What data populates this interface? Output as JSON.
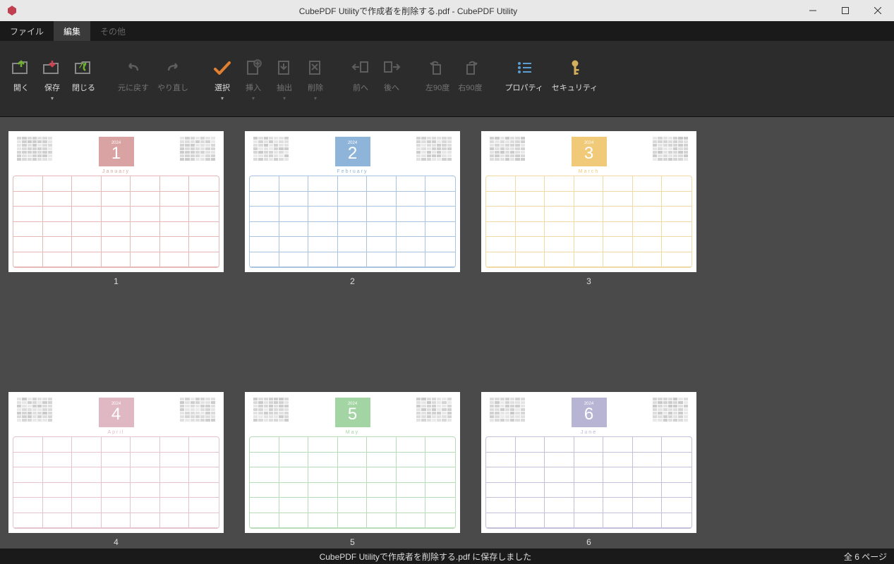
{
  "window": {
    "title": "CubePDF Utilityで作成者を削除する.pdf - CubePDF Utility"
  },
  "menus": {
    "file": "ファイル",
    "edit": "編集",
    "other": "その他"
  },
  "ribbon": {
    "open": "開く",
    "save": "保存",
    "close": "閉じる",
    "undo": "元に戻す",
    "redo": "やり直し",
    "select": "選択",
    "insert": "挿入",
    "extract": "抽出",
    "delete": "削除",
    "prev": "前へ",
    "next": "後へ",
    "rot_left": "左90度",
    "rot_right": "右90度",
    "property": "プロパティ",
    "security": "セキュリティ"
  },
  "thumbnails": [
    {
      "label": "1",
      "month_num": "1",
      "month_name": "January",
      "year": "2024",
      "accent": "#d9a3a3",
      "grid": "#e6b8b8"
    },
    {
      "label": "2",
      "month_num": "2",
      "month_name": "February",
      "year": "2024",
      "accent": "#8fb4d9",
      "grid": "#a8c4e0"
    },
    {
      "label": "3",
      "month_num": "3",
      "month_name": "March",
      "year": "2024",
      "accent": "#f0c979",
      "grid": "#f0d9a3"
    },
    {
      "label": "4",
      "month_num": "4",
      "month_name": "April",
      "year": "2024",
      "accent": "#e0b8c4",
      "grid": "#e6c4ce"
    },
    {
      "label": "5",
      "month_num": "5",
      "month_name": "May",
      "year": "2024",
      "accent": "#a3d4a3",
      "grid": "#b8dcb8"
    },
    {
      "label": "6",
      "month_num": "6",
      "month_name": "June",
      "year": "2024",
      "accent": "#b8b4d4",
      "grid": "#c4c0dc"
    }
  ],
  "status": {
    "message": "CubePDF Utilityで作成者を削除する.pdf に保存しました",
    "pages": "全 6 ページ"
  },
  "colors": {
    "accent_orange": "#e08030",
    "accent_green": "#6fb030",
    "accent_yellow": "#d4af5c"
  }
}
